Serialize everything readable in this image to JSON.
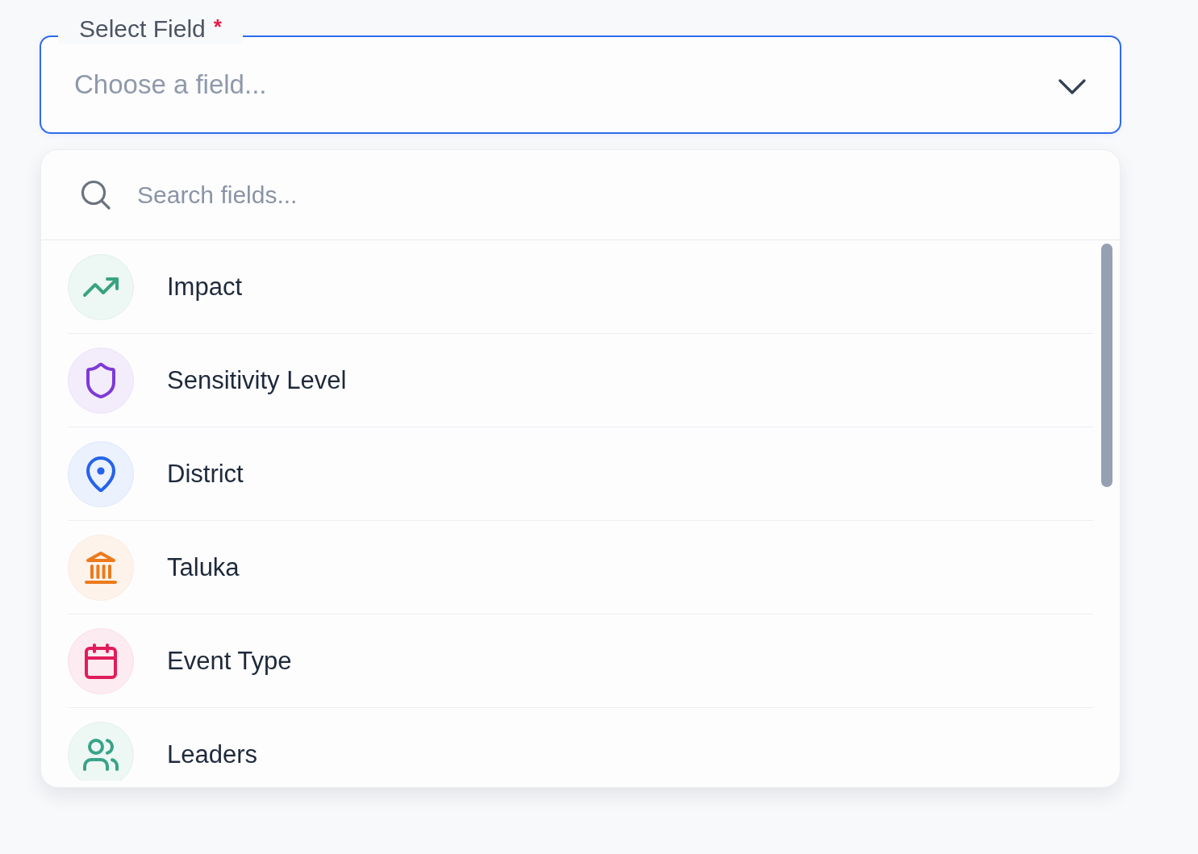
{
  "field": {
    "label": "Select Field",
    "required_mark": "*",
    "placeholder": "Choose a field...",
    "expanded": true
  },
  "dropdown": {
    "search": {
      "placeholder": "Search fields..."
    },
    "options": [
      {
        "label": "Impact",
        "color": "#38a37f",
        "selected": false
      },
      {
        "label": "Sensitivity Level",
        "color": "#7e3ad8",
        "selected": false
      },
      {
        "label": "District",
        "color": "#2563eb",
        "selected": false
      },
      {
        "label": "Taluka",
        "color": "#ec7a1c",
        "selected": false
      },
      {
        "label": "Event Type",
        "color": "#e11d5c",
        "selected": false
      },
      {
        "label": "Leaders",
        "color": "#38a387",
        "selected": false
      }
    ]
  }
}
